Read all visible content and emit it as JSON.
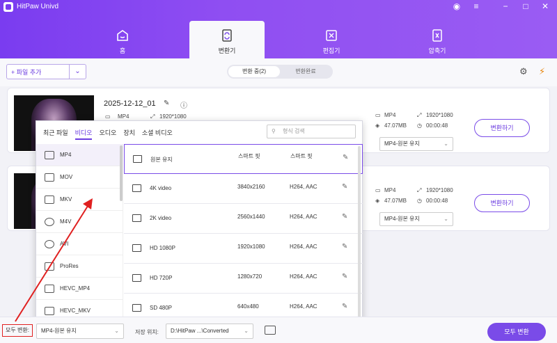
{
  "app": {
    "title": "HitPaw Univd"
  },
  "tabs": [
    {
      "label": "홈"
    },
    {
      "label": "변환기"
    },
    {
      "label": "편집기"
    },
    {
      "label": "압축기"
    }
  ],
  "toolbar": {
    "add_file": "+ 파일 추가",
    "seg_converting": "변환 중(2)",
    "seg_done": "변환완료"
  },
  "files": [
    {
      "name": "2025-12-12_01",
      "src_format": "MP4",
      "src_res": "1920*1080",
      "out_format": "MP4",
      "out_res": "1920*1080",
      "out_size": "47.07MB",
      "out_duration": "00:00:48",
      "select": "MP4-원본 유지",
      "convert_label": "변환하기"
    },
    {
      "name": "",
      "src_format": "",
      "src_res": "",
      "out_format": "MP4",
      "out_res": "1920*1080",
      "out_size": "47.07MB",
      "out_duration": "00:00:48",
      "select": "MP4-원본 유지",
      "convert_label": "변환하기"
    }
  ],
  "popup": {
    "tabs": [
      {
        "label": "최근 파일"
      },
      {
        "label": "비디오"
      },
      {
        "label": "오디오"
      },
      {
        "label": "장치"
      },
      {
        "label": "소셜 비디오"
      }
    ],
    "search_placeholder": "형식 검색",
    "formats": [
      "MP4",
      "MOV",
      "MKV",
      "M4V",
      "AVI",
      "ProRes",
      "HEVC_MP4",
      "HEVC_MKV"
    ],
    "presets": [
      {
        "name": "원본 유지",
        "res": "스마트 핏",
        "codec": "스마트 핏"
      },
      {
        "name": "4K video",
        "res": "3840x2160",
        "codec": "H264, AAC"
      },
      {
        "name": "2K video",
        "res": "2560x1440",
        "codec": "H264, AAC"
      },
      {
        "name": "HD 1080P",
        "res": "1920x1080",
        "codec": "H264, AAC"
      },
      {
        "name": "HD 720P",
        "res": "1280x720",
        "codec": "H264, AAC"
      },
      {
        "name": "SD 480P",
        "res": "640x480",
        "codec": "H264, AAC"
      }
    ]
  },
  "bottom": {
    "all_label": "모두 변환:",
    "all_select": "MP4-원본 유지",
    "save_label": "저장 위치:",
    "save_path": "D:\\HitPaw ...\\Converted",
    "all_convert": "모두 변환"
  },
  "colors": {
    "accent": "#7a4be8",
    "annotation": "#e02020"
  }
}
